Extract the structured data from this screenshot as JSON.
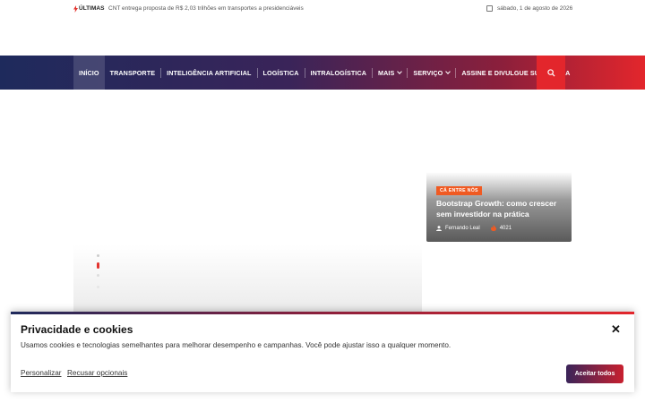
{
  "topbar": {
    "latest_label": "ÚLTIMAS",
    "latest_news": "CNT entrega proposta de R$ 2,03 trilhões em transportes a presidenciáveis",
    "date": "sábado, 1 de agosto de 2026",
    "icons": [
      "flash-icon",
      "calendar-icon"
    ]
  },
  "nav": {
    "items": [
      {
        "label": "INÍCIO",
        "active": true
      },
      {
        "label": "TRANSPORTE"
      },
      {
        "label": "INTELIGÊNCIA ARTIFICIAL"
      },
      {
        "label": "LOGÍSTICA"
      },
      {
        "label": "INTRALOGÍSTICA"
      },
      {
        "label": "MAIS",
        "dropdown": true
      },
      {
        "label": "SERVIÇO",
        "dropdown": true
      },
      {
        "label": "ASSINE E DIVULGUE SUA MARCA"
      }
    ],
    "search_icon": "search-icon"
  },
  "feature_card": {
    "category": "CÁ ENTRE NÓS",
    "title": "Bootstrap Growth: como crescer sem investidor na prática",
    "author": "Fernando Leal",
    "views": "4021"
  },
  "cookie_banner": {
    "title": "Privacidade e cookies",
    "text": "Usamos cookies e tecnologias semelhantes para melhorar desempenho e campanhas. Você pode ajustar isso a qualquer momento.",
    "customize_label": "Personalizar",
    "reject_label": "Recusar opcionais",
    "accept_label": "Aceitar todos",
    "close_label": "✕"
  },
  "colors": {
    "accent_red": "#e3262c",
    "nav_dark": "#1e2a5c",
    "badge_orange": "#f05a22"
  }
}
